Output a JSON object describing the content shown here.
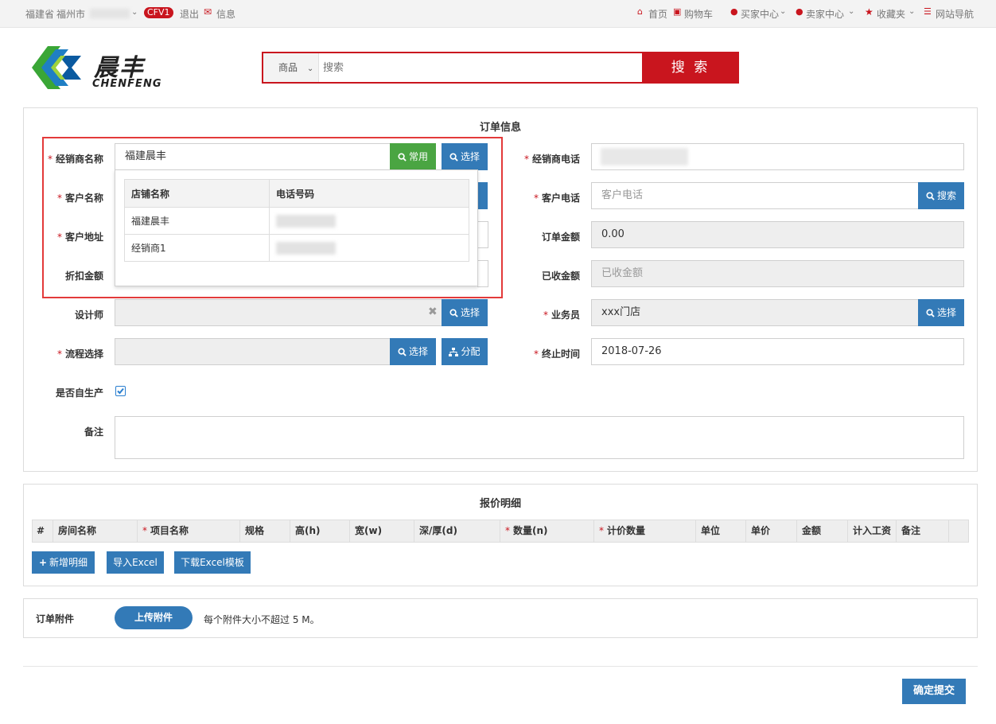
{
  "topbar": {
    "province": "福建省",
    "city": "福州市",
    "badge": "CFV1",
    "logout": "退出",
    "message": "信息",
    "home": "首页",
    "cart": "购物车",
    "buyer_center": "买家中心",
    "seller_center": "卖家中心",
    "favorites": "收藏夹",
    "site_nav": "网站导航"
  },
  "logo": {
    "cn": "晨丰",
    "en": "CHENFENG"
  },
  "search": {
    "category": "商品",
    "placeholder": "搜索",
    "value": "搜索",
    "button": "搜 索"
  },
  "order": {
    "title": "订单信息",
    "dealer_name_label": "经销商名称",
    "dealer_name_value": "福建晨丰",
    "common_button": "常用",
    "select_button": "选择",
    "customer_name_label": "客户名称",
    "customer_address_label": "客户地址",
    "discount_label": "折扣金额",
    "designer_label": "设计师",
    "process_label": "流程选择",
    "assign_button": "分配",
    "self_produce_label": "是否自生产",
    "self_produce_checked": true,
    "remark_label": "备注",
    "dealer_phone_label": "经销商电话",
    "customer_phone_label": "客户电话",
    "customer_phone_placeholder": "客户电话",
    "search_button": "搜索",
    "order_amount_label": "订单金额",
    "order_amount_value": "0.00",
    "received_label": "已收金额",
    "received_placeholder": "已收金额",
    "salesman_label": "业务员",
    "salesman_value": "xxx门店",
    "deadline_label": "终止时间",
    "deadline_value": "2018-07-26"
  },
  "dropdown": {
    "headers": [
      "店铺名称",
      "电话号码"
    ],
    "rows": [
      [
        "福建晨丰",
        ""
      ],
      [
        "经销商1",
        ""
      ]
    ]
  },
  "quote": {
    "title": "报价明细",
    "columns": [
      {
        "label": "#",
        "required": false
      },
      {
        "label": "房间名称",
        "required": false
      },
      {
        "label": "项目名称",
        "required": true
      },
      {
        "label": "规格",
        "required": false
      },
      {
        "label": "高(h)",
        "required": false
      },
      {
        "label": "宽(w)",
        "required": false
      },
      {
        "label": "深/厚(d)",
        "required": false
      },
      {
        "label": "数量(n)",
        "required": true
      },
      {
        "label": "计价数量",
        "required": true
      },
      {
        "label": "单位",
        "required": false
      },
      {
        "label": "单价",
        "required": false
      },
      {
        "label": "金额",
        "required": false
      },
      {
        "label": "计入工资",
        "required": false
      },
      {
        "label": "备注",
        "required": false
      }
    ],
    "add_button": "新增明细",
    "import_button": "导入Excel",
    "download_button": "下载Excel模板"
  },
  "attachment": {
    "label": "订单附件",
    "upload_button": "上传附件",
    "note": "每个附件大小不超过 5 M。"
  },
  "submit_button": "确定提交"
}
